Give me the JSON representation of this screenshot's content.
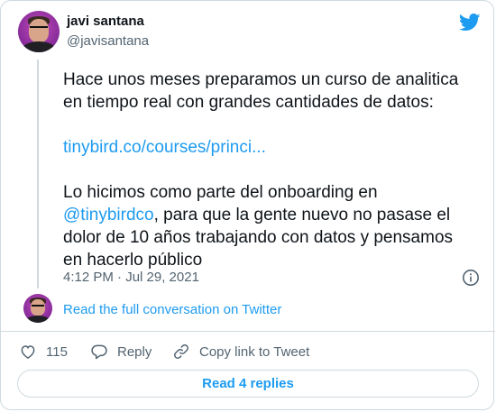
{
  "author": {
    "name": "javi santana",
    "handle": "@javisantana"
  },
  "tweet": {
    "line1": "Hace unos meses preparamos un curso de analitica\nen tiempo real con grandes cantidades de datos:",
    "link_text": "tinybird.co/courses/princi...",
    "para2_before": "Lo hicimos como parte del onboarding en\n",
    "mention": "@tinybirdco",
    "para2_after": ", para que la gente nuevo no pasase el\ndolor de 10 años trabajando con datos y pensamos\nen hacerlo público"
  },
  "meta": {
    "timestamp": "4:12 PM · Jul 29, 2021"
  },
  "conversation": {
    "label": "Read the full conversation on Twitter"
  },
  "actions": {
    "like_count": "115",
    "reply_label": "Reply",
    "copy_label": "Copy link to Tweet"
  },
  "replies": {
    "label": "Read 4 replies"
  },
  "icons": {
    "brand": "twitter-bird-icon",
    "info": "info-icon",
    "like": "heart-icon",
    "reply": "speech-bubble-icon",
    "copy": "link-icon"
  },
  "colors": {
    "accent": "#1d9bf0",
    "text": "#0f1419",
    "muted": "#536471",
    "border": "#cfd9de"
  }
}
